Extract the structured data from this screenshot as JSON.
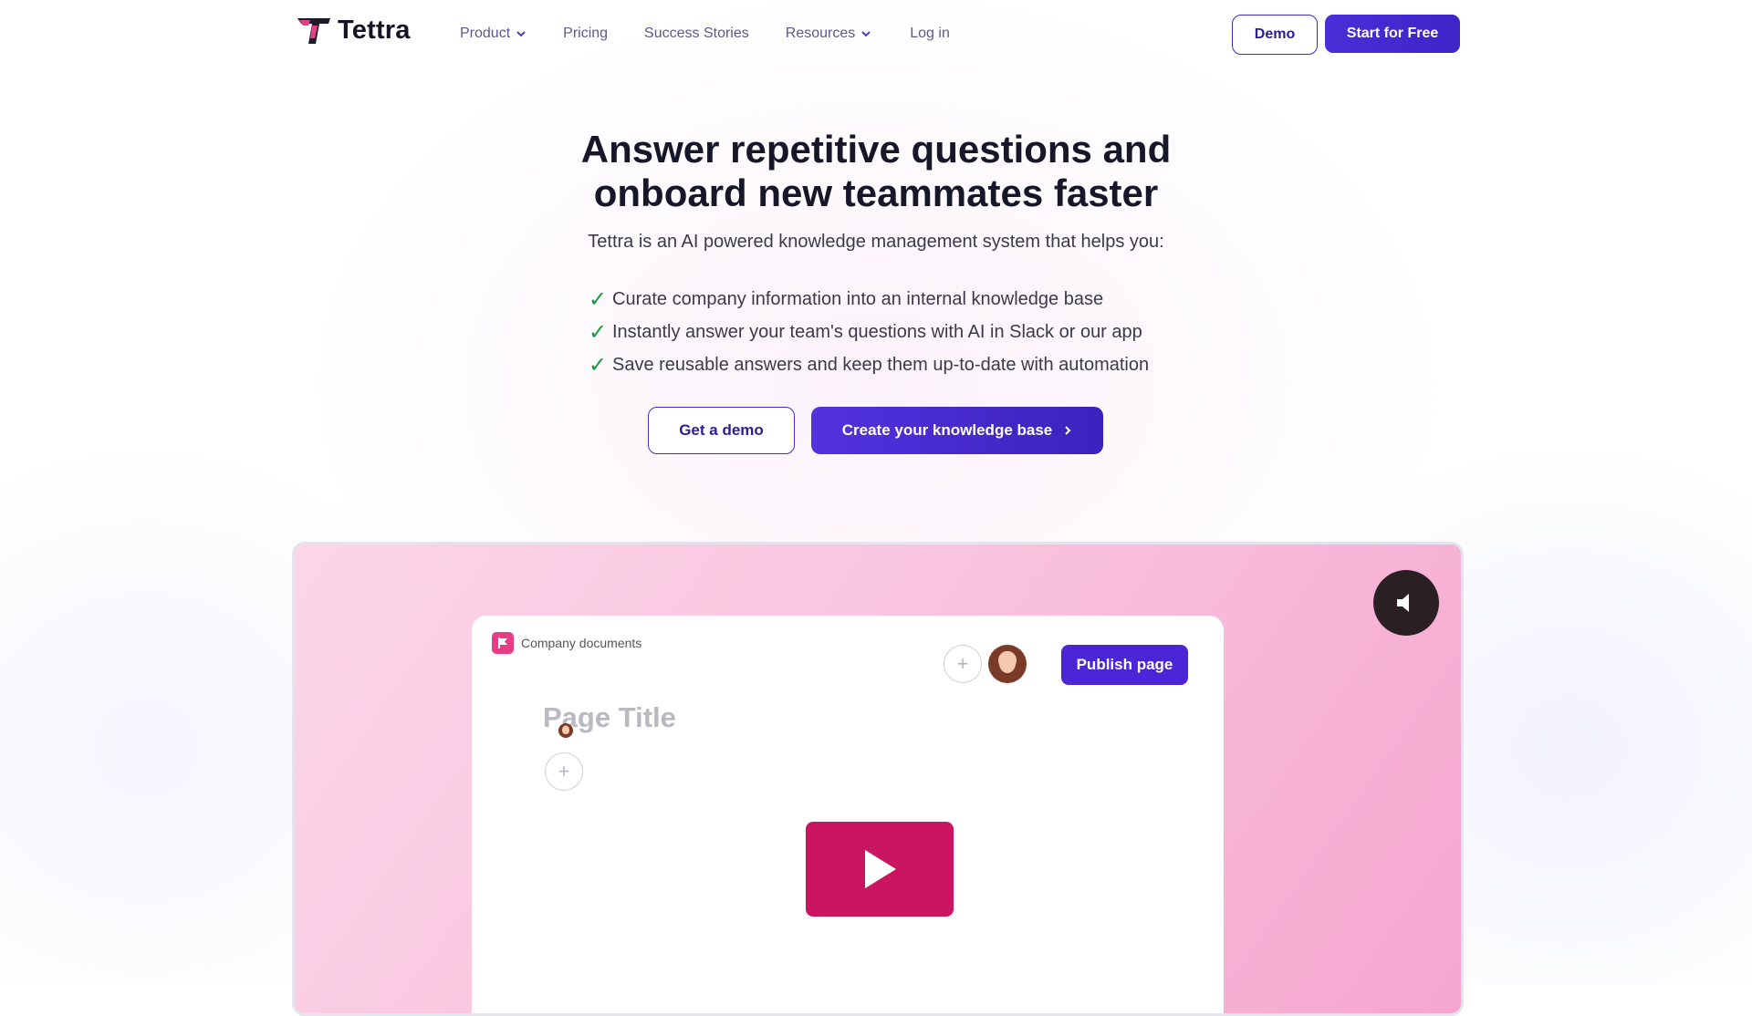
{
  "colors": {
    "brand_purple": "#4a2fd8",
    "brand_pink": "#e83d86",
    "play_red": "#cc1560",
    "check_green": "#1c9b3e",
    "nav_text": "#5a5a8a"
  },
  "header": {
    "logo_text": "Tettra",
    "logo_icon": "tettra-t-logo",
    "nav": [
      {
        "label": "Product",
        "has_dropdown": true
      },
      {
        "label": "Pricing",
        "has_dropdown": false
      },
      {
        "label": "Success Stories",
        "has_dropdown": false
      },
      {
        "label": "Resources",
        "has_dropdown": true
      },
      {
        "label": "Log in",
        "has_dropdown": false
      }
    ],
    "demo_label": "Demo",
    "start_label": "Start for Free"
  },
  "hero": {
    "title_line1": "Answer repetitive questions and",
    "title_line2": "onboard new teammates faster",
    "subtitle": "Tettra is an AI powered knowledge management system that helps you:",
    "check_icon": "checkmark-icon",
    "benefits": [
      "Curate company information into an internal knowledge base",
      "Instantly answer your team's questions with AI in Slack or our app",
      "Save reusable answers and keep them up-to-date with automation"
    ],
    "cta_demo": "Get a demo",
    "cta_create": "Create your knowledge base"
  },
  "video": {
    "mute_icon": "speaker-muted-icon",
    "play_icon": "play-icon",
    "doc_folder_label": "Company documents",
    "publish_label": "Publish page",
    "page_title_placeholder": "Page Title"
  }
}
